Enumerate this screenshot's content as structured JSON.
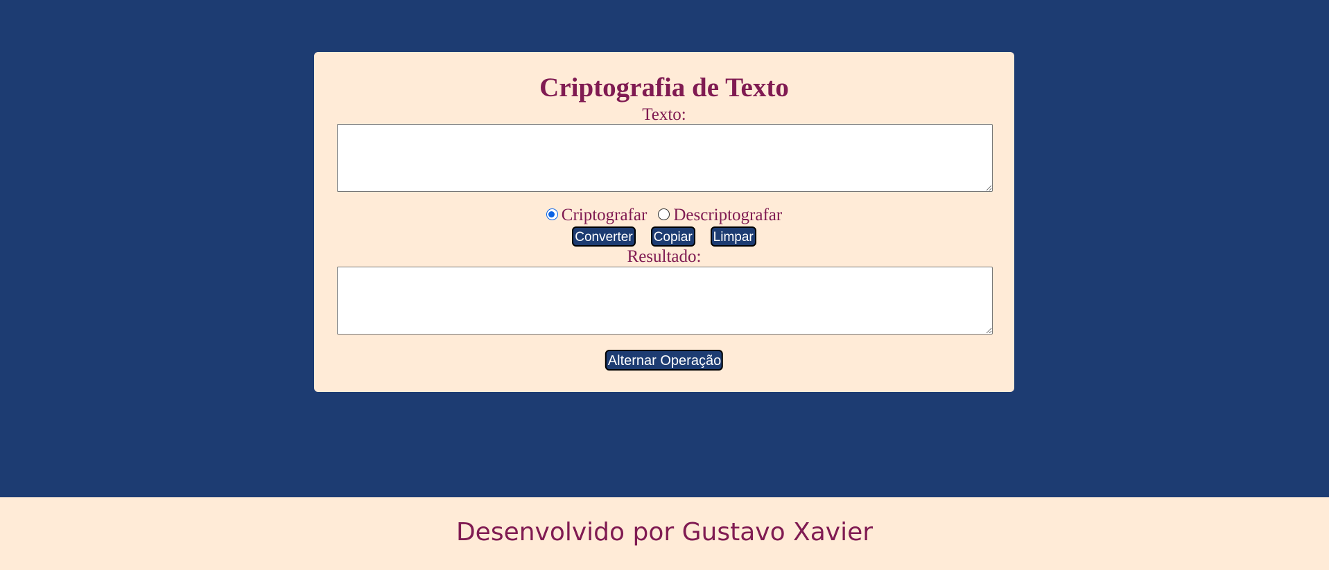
{
  "colors": {
    "background": "#1d3c72",
    "card": "#ffebd7",
    "accent_text": "#801b52",
    "button_bg": "#1d3c72",
    "button_text": "#ffffff",
    "radio_checked": "#0b63e5"
  },
  "card": {
    "title": "Criptografia de Texto",
    "input_label": "Texto:",
    "input_value": "",
    "modes": [
      {
        "label": "Criptografar",
        "checked": true
      },
      {
        "label": "Descriptografar",
        "checked": false
      }
    ],
    "buttons": {
      "convert": "Converter",
      "copy": "Copiar",
      "clear": "Limpar"
    },
    "result_label": "Resultado:",
    "result_value": "",
    "toggle_button": "Alternar Operação"
  },
  "footer": {
    "text": "Desenvolvido por Gustavo Xavier"
  }
}
